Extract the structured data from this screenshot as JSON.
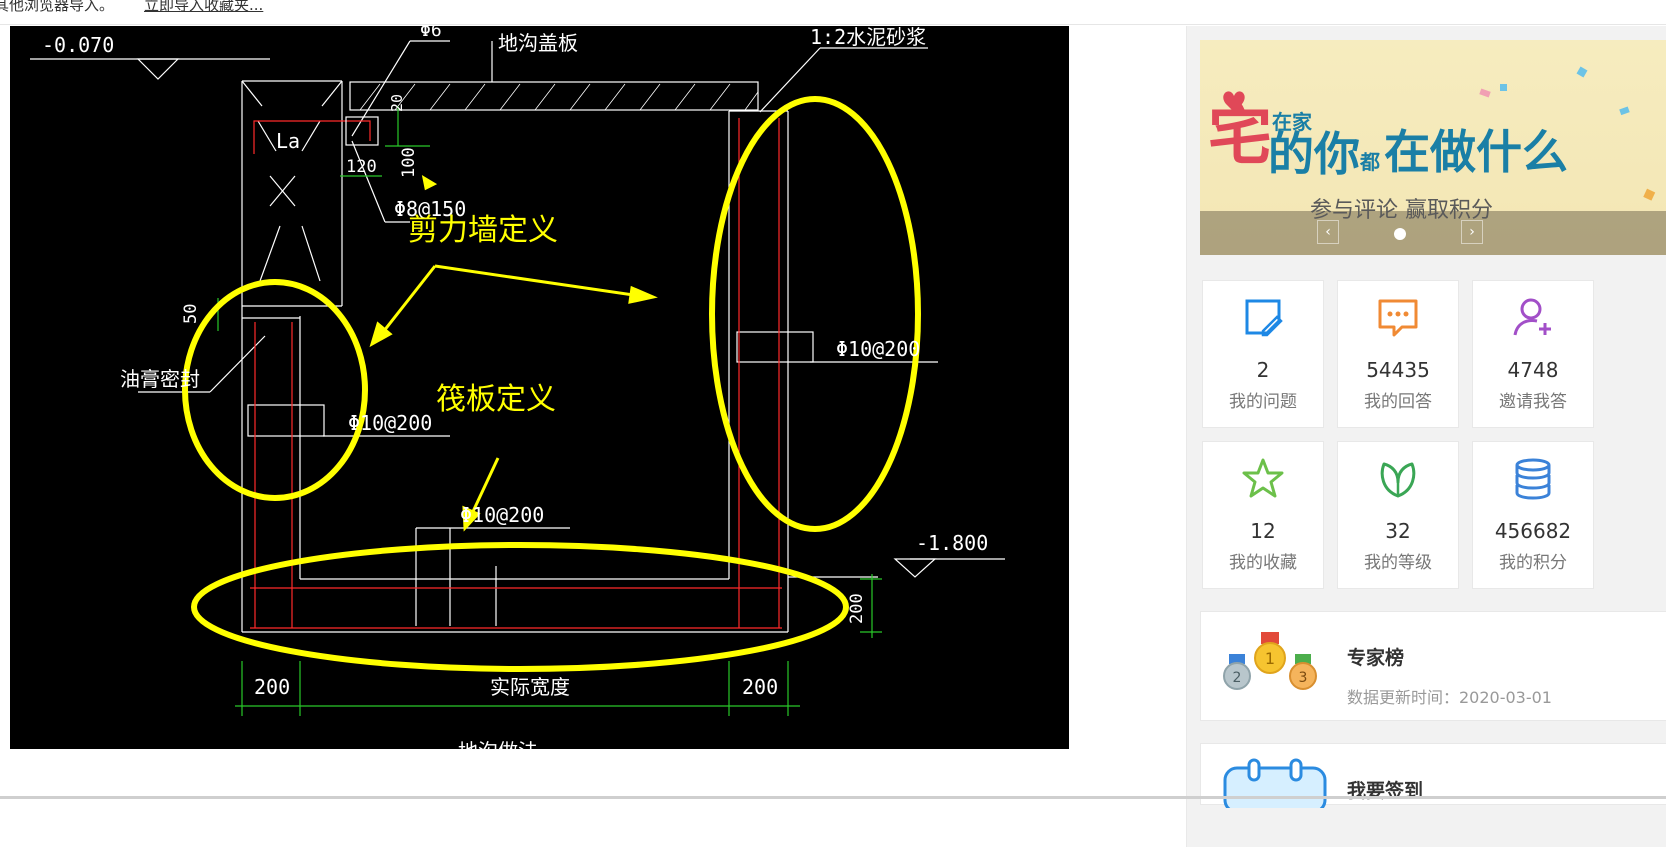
{
  "topbar": {
    "message": "其他浏览器导入。",
    "import_link": "立即导入收藏夹..."
  },
  "drawing": {
    "labels": {
      "level_top": "-0.070",
      "rebar_top": "Φ6",
      "trench_cover": "地沟盖板",
      "mortar": "1:2水泥砂浆",
      "la": "La",
      "dim_120": "120",
      "dim_20": "20",
      "dim_100": "100",
      "rebar_8_150": "Φ8@150",
      "dim_50": "50",
      "seal": "油膏密封",
      "rebar_10_200_left": "Φ10@200",
      "rebar_10_200_right": "Φ10@200",
      "rebar_10_200_bottom": "Φ10@200",
      "level_bottom": "-1.800",
      "dim_200_side": "200",
      "dim_200_left": "200",
      "actual_width": "实际宽度",
      "dim_200_right": "200",
      "caption_partial": "地沟做法"
    },
    "annotations": {
      "shear_wall": "剪力墙定义",
      "raft": "筏板定义"
    },
    "colors": {
      "background": "#000000",
      "line_white": "#ffffff",
      "rebar_red": "#ff2a2a",
      "dimension_green": "#29c829",
      "annotation_yellow": "#ffff00"
    }
  },
  "sidebar": {
    "banner": {
      "headline_prefix": "宅",
      "headline_small": "在家",
      "headline_mid": "的你",
      "headline_small2": "都",
      "headline_main": "在做什么",
      "subtitle": "参与评论 赢取积分",
      "prev_icon": "chevron-left",
      "next_icon": "chevron-right"
    },
    "tiles": [
      {
        "icon": "edit-note-icon",
        "value": "2",
        "label": "我的问题",
        "color": "#1e88e5"
      },
      {
        "icon": "chat-bubble-icon",
        "value": "54435",
        "label": "我的回答",
        "color": "#f08a34"
      },
      {
        "icon": "invite-user-icon",
        "value": "4748",
        "label": "邀请我答",
        "color": "#a24fc8"
      },
      {
        "icon": "star-icon",
        "value": "12",
        "label": "我的收藏",
        "color": "#6cc04a"
      },
      {
        "icon": "leaf-icon",
        "value": "32",
        "label": "我的等级",
        "color": "#3aa655"
      },
      {
        "icon": "coins-stack-icon",
        "value": "456682",
        "label": "我的积分",
        "color": "#3b82d8"
      }
    ],
    "expert": {
      "title": "专家榜",
      "update": "数据更新时间：2020-03-01"
    },
    "signin": {
      "title": "我要签到"
    }
  }
}
